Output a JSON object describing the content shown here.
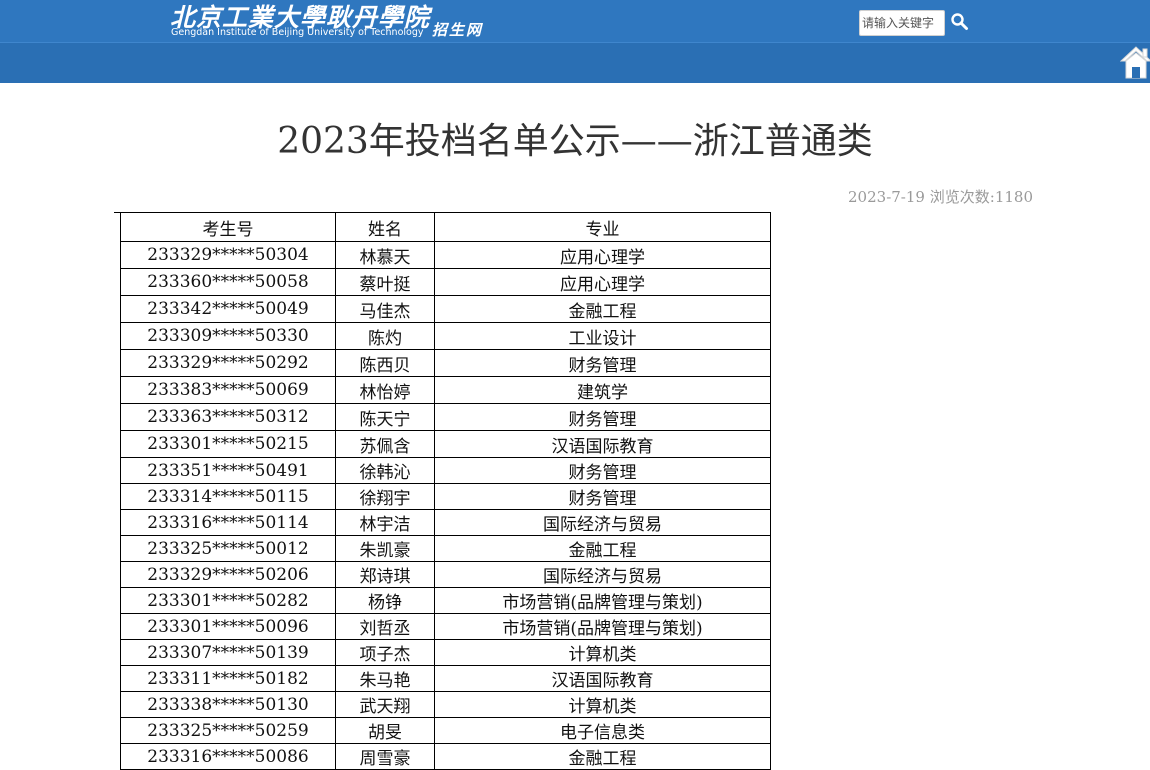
{
  "header": {
    "logo_cn": "北京工業大學耿丹學院",
    "logo_en": "Gengdan Institute of Beijing University of Technology",
    "logo_sub": "招生网",
    "search_placeholder": "请输入关键字",
    "search_icon": "search-icon",
    "home_icon": "home-icon"
  },
  "article": {
    "title": "2023年投档名单公示——浙江普通类",
    "date": "2023-7-19",
    "views_label": "浏览次数:",
    "views": "1180"
  },
  "table": {
    "headers": [
      "考生号",
      "姓名",
      "专业"
    ],
    "rows": [
      [
        "233329*****50304",
        "林慕天",
        "应用心理学"
      ],
      [
        "233360*****50058",
        "蔡叶挺",
        "应用心理学"
      ],
      [
        "233342*****50049",
        "马佳杰",
        "金融工程"
      ],
      [
        "233309*****50330",
        "陈灼",
        "工业设计"
      ],
      [
        "233329*****50292",
        "陈西贝",
        "财务管理"
      ],
      [
        "233383*****50069",
        "林怡婷",
        "建筑学"
      ],
      [
        "233363*****50312",
        "陈天宁",
        "财务管理"
      ],
      [
        "233301*****50215",
        "苏佩含",
        "汉语国际教育"
      ],
      [
        "233351*****50491",
        "徐韩沁",
        "财务管理"
      ],
      [
        "233314*****50115",
        "徐翔宇",
        "财务管理"
      ],
      [
        "233316*****50114",
        "林宇洁",
        "国际经济与贸易"
      ],
      [
        "233325*****50012",
        "朱凯豪",
        "金融工程"
      ],
      [
        "233329*****50206",
        "郑诗琪",
        "国际经济与贸易"
      ],
      [
        "233301*****50282",
        "杨铮",
        "市场营销(品牌管理与策划)"
      ],
      [
        "233301*****50096",
        "刘哲丞",
        "市场营销(品牌管理与策划)"
      ],
      [
        "233307*****50139",
        "项子杰",
        "计算机类"
      ],
      [
        "233311*****50182",
        "朱马艳",
        "汉语国际教育"
      ],
      [
        "233338*****50130",
        "武天翔",
        "计算机类"
      ],
      [
        "233325*****50259",
        "胡旻",
        "电子信息类"
      ],
      [
        "233316*****50086",
        "周雪豪",
        "金融工程"
      ]
    ]
  }
}
